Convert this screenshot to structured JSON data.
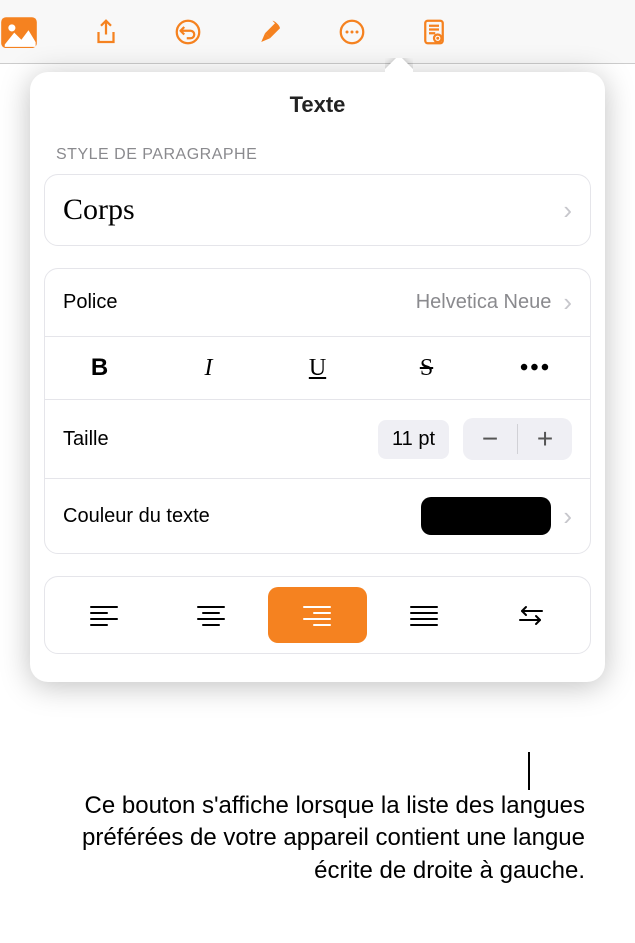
{
  "panel": {
    "title": "Texte",
    "sectionHeader": "STYLE DE PARAGRAPHE",
    "styleName": "Corps"
  },
  "font": {
    "label": "Police",
    "value": "Helvetica Neue"
  },
  "styleButtons": {
    "bold": "B",
    "italic": "I",
    "underline": "U",
    "strike": "S",
    "more": "•••"
  },
  "size": {
    "label": "Taille",
    "value": "11 pt",
    "minus": "−",
    "plus": "+"
  },
  "color": {
    "label": "Couleur du texte",
    "value": "#000000"
  },
  "alignment": {
    "active": "right"
  },
  "caption": "Ce bouton s'affiche lorsque la liste des langues préférées de votre appareil contient une langue écrite de droite à gauche."
}
